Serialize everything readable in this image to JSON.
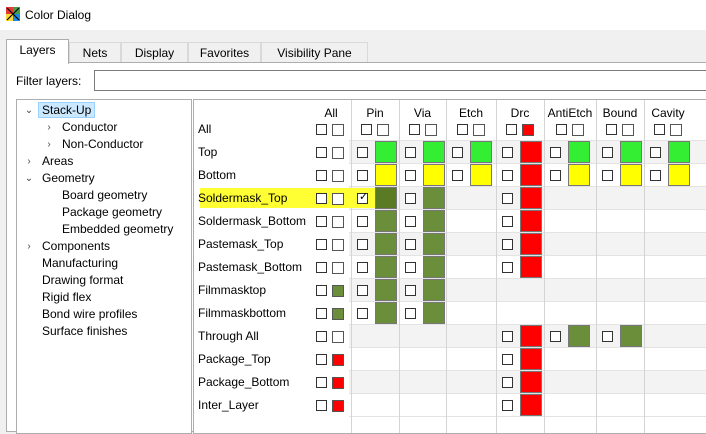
{
  "window": {
    "title": "Color Dialog",
    "icon": "color-dialog-app-icon"
  },
  "tabs": [
    {
      "label": "Layers",
      "active": true
    },
    {
      "label": "Nets"
    },
    {
      "label": "Display"
    },
    {
      "label": "Favorites"
    },
    {
      "label": "Visibility Pane"
    }
  ],
  "filter": {
    "label": "Filter layers:",
    "value": ""
  },
  "tree": [
    {
      "label": "Stack-Up",
      "level": 0,
      "arrow": "expanded",
      "selected": true
    },
    {
      "label": "Conductor",
      "level": 1,
      "arrow": "collapsed"
    },
    {
      "label": "Non-Conductor",
      "level": 1,
      "arrow": "collapsed"
    },
    {
      "label": "Areas",
      "level": 0,
      "arrow": "collapsed"
    },
    {
      "label": "Geometry",
      "level": 0,
      "arrow": "expanded"
    },
    {
      "label": "Board geometry",
      "level": 1,
      "arrow": ""
    },
    {
      "label": "Package geometry",
      "level": 1,
      "arrow": ""
    },
    {
      "label": "Embedded geometry",
      "level": 1,
      "arrow": ""
    },
    {
      "label": "Components",
      "level": 0,
      "arrow": "collapsed"
    },
    {
      "label": "Manufacturing",
      "level": 0,
      "arrow": ""
    },
    {
      "label": "Drawing format",
      "level": 0,
      "arrow": ""
    },
    {
      "label": "Rigid flex",
      "level": 0,
      "arrow": ""
    },
    {
      "label": "Bond wire profiles",
      "level": 0,
      "arrow": ""
    },
    {
      "label": "Surface finishes",
      "level": 0,
      "arrow": ""
    }
  ],
  "colors": {
    "green": "#33ee33",
    "yellow": "#ffff00",
    "red": "#ff0000",
    "olive": "#6b8e3a",
    "dark_olive": "#5a7a23",
    "highlight": "#ffff33"
  },
  "grid": {
    "columns": [
      "All",
      "Pin",
      "Via",
      "Etch",
      "Drc",
      "AntiEtch",
      "Bound",
      "Cavity"
    ],
    "header_row": {
      "label": "All",
      "all": [
        "",
        ""
      ],
      "cells": {
        "Pin": [
          "",
          ""
        ],
        "Via": [
          "",
          ""
        ],
        "Etch": [
          "",
          ""
        ],
        "Drc": [
          "",
          "red"
        ],
        "AntiEtch": [
          "",
          ""
        ],
        "Bound": [
          "",
          ""
        ],
        "Cavity": [
          "",
          ""
        ]
      }
    },
    "rows": [
      {
        "label": "Top",
        "all": [
          "",
          ""
        ],
        "cells": {
          "Pin": "green",
          "Via": "green",
          "Etch": "green",
          "Drc": "red",
          "AntiEtch": "green",
          "Bound": "green",
          "Cavity": "green"
        }
      },
      {
        "label": "Bottom",
        "all": [
          "",
          ""
        ],
        "cells": {
          "Pin": "yellow",
          "Via": "yellow",
          "Etch": "yellow",
          "Drc": "red",
          "AntiEtch": "yellow",
          "Bound": "yellow",
          "Cavity": "yellow"
        }
      },
      {
        "label": "Soldermask_Top",
        "highlight": true,
        "all": [
          "",
          ""
        ],
        "pin_checked": true,
        "cells": {
          "Pin": "dark_olive",
          "Via": "olive",
          "Drc": "red"
        }
      },
      {
        "label": "Soldermask_Bottom",
        "all": [
          "",
          ""
        ],
        "cells": {
          "Pin": "olive",
          "Via": "olive",
          "Drc": "red"
        }
      },
      {
        "label": "Pastemask_Top",
        "all": [
          "",
          ""
        ],
        "cells": {
          "Pin": "olive",
          "Via": "olive",
          "Drc": "red"
        }
      },
      {
        "label": "Pastemask_Bottom",
        "all": [
          "",
          ""
        ],
        "cells": {
          "Pin": "olive",
          "Via": "olive",
          "Drc": "red"
        }
      },
      {
        "label": "Filmmasktop",
        "all": [
          "",
          "olive"
        ],
        "cells": {
          "Pin": "olive",
          "Via": "olive"
        }
      },
      {
        "label": "Filmmaskbottom",
        "all": [
          "",
          "olive"
        ],
        "cells": {
          "Pin": "olive",
          "Via": "olive"
        }
      },
      {
        "label": "Through All",
        "all": [
          "",
          ""
        ],
        "cells": {
          "Drc": "red",
          "AntiEtch": "olive",
          "Bound": "olive"
        }
      },
      {
        "label": "Package_Top",
        "all": [
          "",
          "red"
        ],
        "cells": {
          "Drc": "red"
        }
      },
      {
        "label": "Package_Bottom",
        "all": [
          "",
          "red"
        ],
        "cells": {
          "Drc": "red"
        }
      },
      {
        "label": "Inter_Layer",
        "all": [
          "",
          "red"
        ],
        "cells": {
          "Drc": "red"
        }
      }
    ]
  }
}
